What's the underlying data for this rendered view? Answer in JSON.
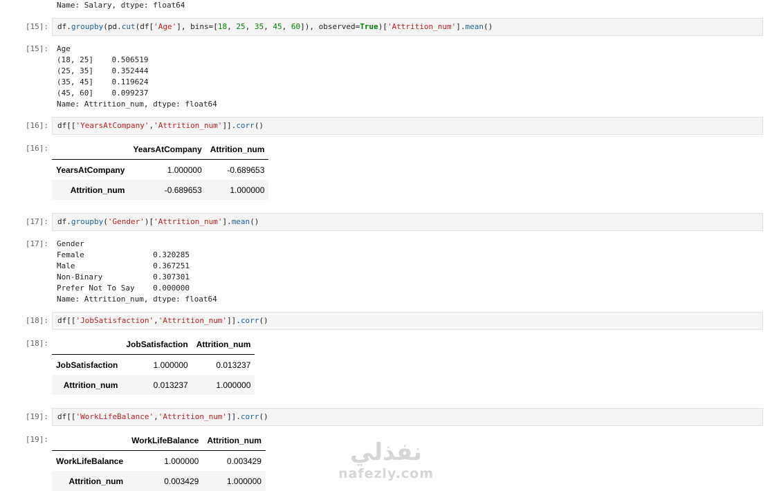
{
  "top_line": "Name: Salary, dtype: float64",
  "cells": [
    {
      "prompt_in": "[15]:",
      "code": [
        [
          "n",
          "df."
        ],
        [
          "f",
          "groupby"
        ],
        [
          "n",
          "(pd."
        ],
        [
          "f",
          "cut"
        ],
        [
          "n",
          "(df["
        ],
        [
          "s",
          "'Age'"
        ],
        [
          "n",
          "], bins=["
        ],
        [
          "d",
          "18"
        ],
        [
          "n",
          ", "
        ],
        [
          "d",
          "25"
        ],
        [
          "n",
          ", "
        ],
        [
          "d",
          "35"
        ],
        [
          "n",
          ", "
        ],
        [
          "d",
          "45"
        ],
        [
          "n",
          ", "
        ],
        [
          "d",
          "60"
        ],
        [
          "n",
          "]), observed="
        ],
        [
          "k",
          "True"
        ],
        [
          "n",
          ")["
        ],
        [
          "s",
          "'Attrition_num'"
        ],
        [
          "n",
          "]."
        ],
        [
          "f",
          "mean"
        ],
        [
          "n",
          "()"
        ]
      ],
      "prompt_out": "[15]:",
      "output_text": "Age\n(18, 25]    0.506519\n(25, 35]    0.352444\n(35, 45]    0.119624\n(45, 60]    0.099237\nName: Attrition_num, dtype: float64"
    },
    {
      "prompt_in": "[16]:",
      "code": [
        [
          "n",
          "df[["
        ],
        [
          "s",
          "'YearsAtCompany'"
        ],
        [
          "n",
          ","
        ],
        [
          "s",
          "'Attrition_num'"
        ],
        [
          "n",
          "]]."
        ],
        [
          "f",
          "corr"
        ],
        [
          "n",
          "()"
        ]
      ],
      "prompt_out": "[16]:",
      "table": {
        "columns": [
          "YearsAtCompany",
          "Attrition_num"
        ],
        "rows": [
          {
            "index": "YearsAtCompany",
            "values": [
              "1.000000",
              "-0.689653"
            ]
          },
          {
            "index": "Attrition_num",
            "values": [
              "-0.689653",
              "1.000000"
            ]
          }
        ]
      }
    },
    {
      "prompt_in": "[17]:",
      "code": [
        [
          "n",
          "df."
        ],
        [
          "f",
          "groupby"
        ],
        [
          "n",
          "("
        ],
        [
          "s",
          "'Gender'"
        ],
        [
          "n",
          ")["
        ],
        [
          "s",
          "'Attrition_num'"
        ],
        [
          "n",
          "]."
        ],
        [
          "f",
          "mean"
        ],
        [
          "n",
          "()"
        ]
      ],
      "prompt_out": "[17]:",
      "output_text": "Gender\nFemale               0.320285\nMale                 0.367251\nNon-Binary           0.307301\nPrefer Not To Say    0.000000\nName: Attrition_num, dtype: float64"
    },
    {
      "prompt_in": "[18]:",
      "code": [
        [
          "n",
          "df[["
        ],
        [
          "s",
          "'JobSatisfaction'"
        ],
        [
          "n",
          ","
        ],
        [
          "s",
          "'Attrition_num'"
        ],
        [
          "n",
          "]]."
        ],
        [
          "f",
          "corr"
        ],
        [
          "n",
          "()"
        ]
      ],
      "prompt_out": "[18]:",
      "table": {
        "columns": [
          "JobSatisfaction",
          "Attrition_num"
        ],
        "rows": [
          {
            "index": "JobSatisfaction",
            "values": [
              "1.000000",
              "0.013237"
            ]
          },
          {
            "index": "Attrition_num",
            "values": [
              "0.013237",
              "1.000000"
            ]
          }
        ]
      }
    },
    {
      "prompt_in": "[19]:",
      "code": [
        [
          "n",
          "df[["
        ],
        [
          "s",
          "'WorkLifeBalance'"
        ],
        [
          "n",
          ","
        ],
        [
          "s",
          "'Attrition_num'"
        ],
        [
          "n",
          "]]."
        ],
        [
          "f",
          "corr"
        ],
        [
          "n",
          "()"
        ]
      ],
      "prompt_out": "[19]:",
      "table": {
        "columns": [
          "WorkLifeBalance",
          "Attrition_num"
        ],
        "rows": [
          {
            "index": "WorkLifeBalance",
            "values": [
              "1.000000",
              "0.003429"
            ]
          },
          {
            "index": "Attrition_num",
            "values": [
              "0.003429",
              "1.000000"
            ]
          }
        ]
      }
    }
  ],
  "watermark": {
    "arabic": "نفذلي",
    "latin": "nafezly.com"
  }
}
